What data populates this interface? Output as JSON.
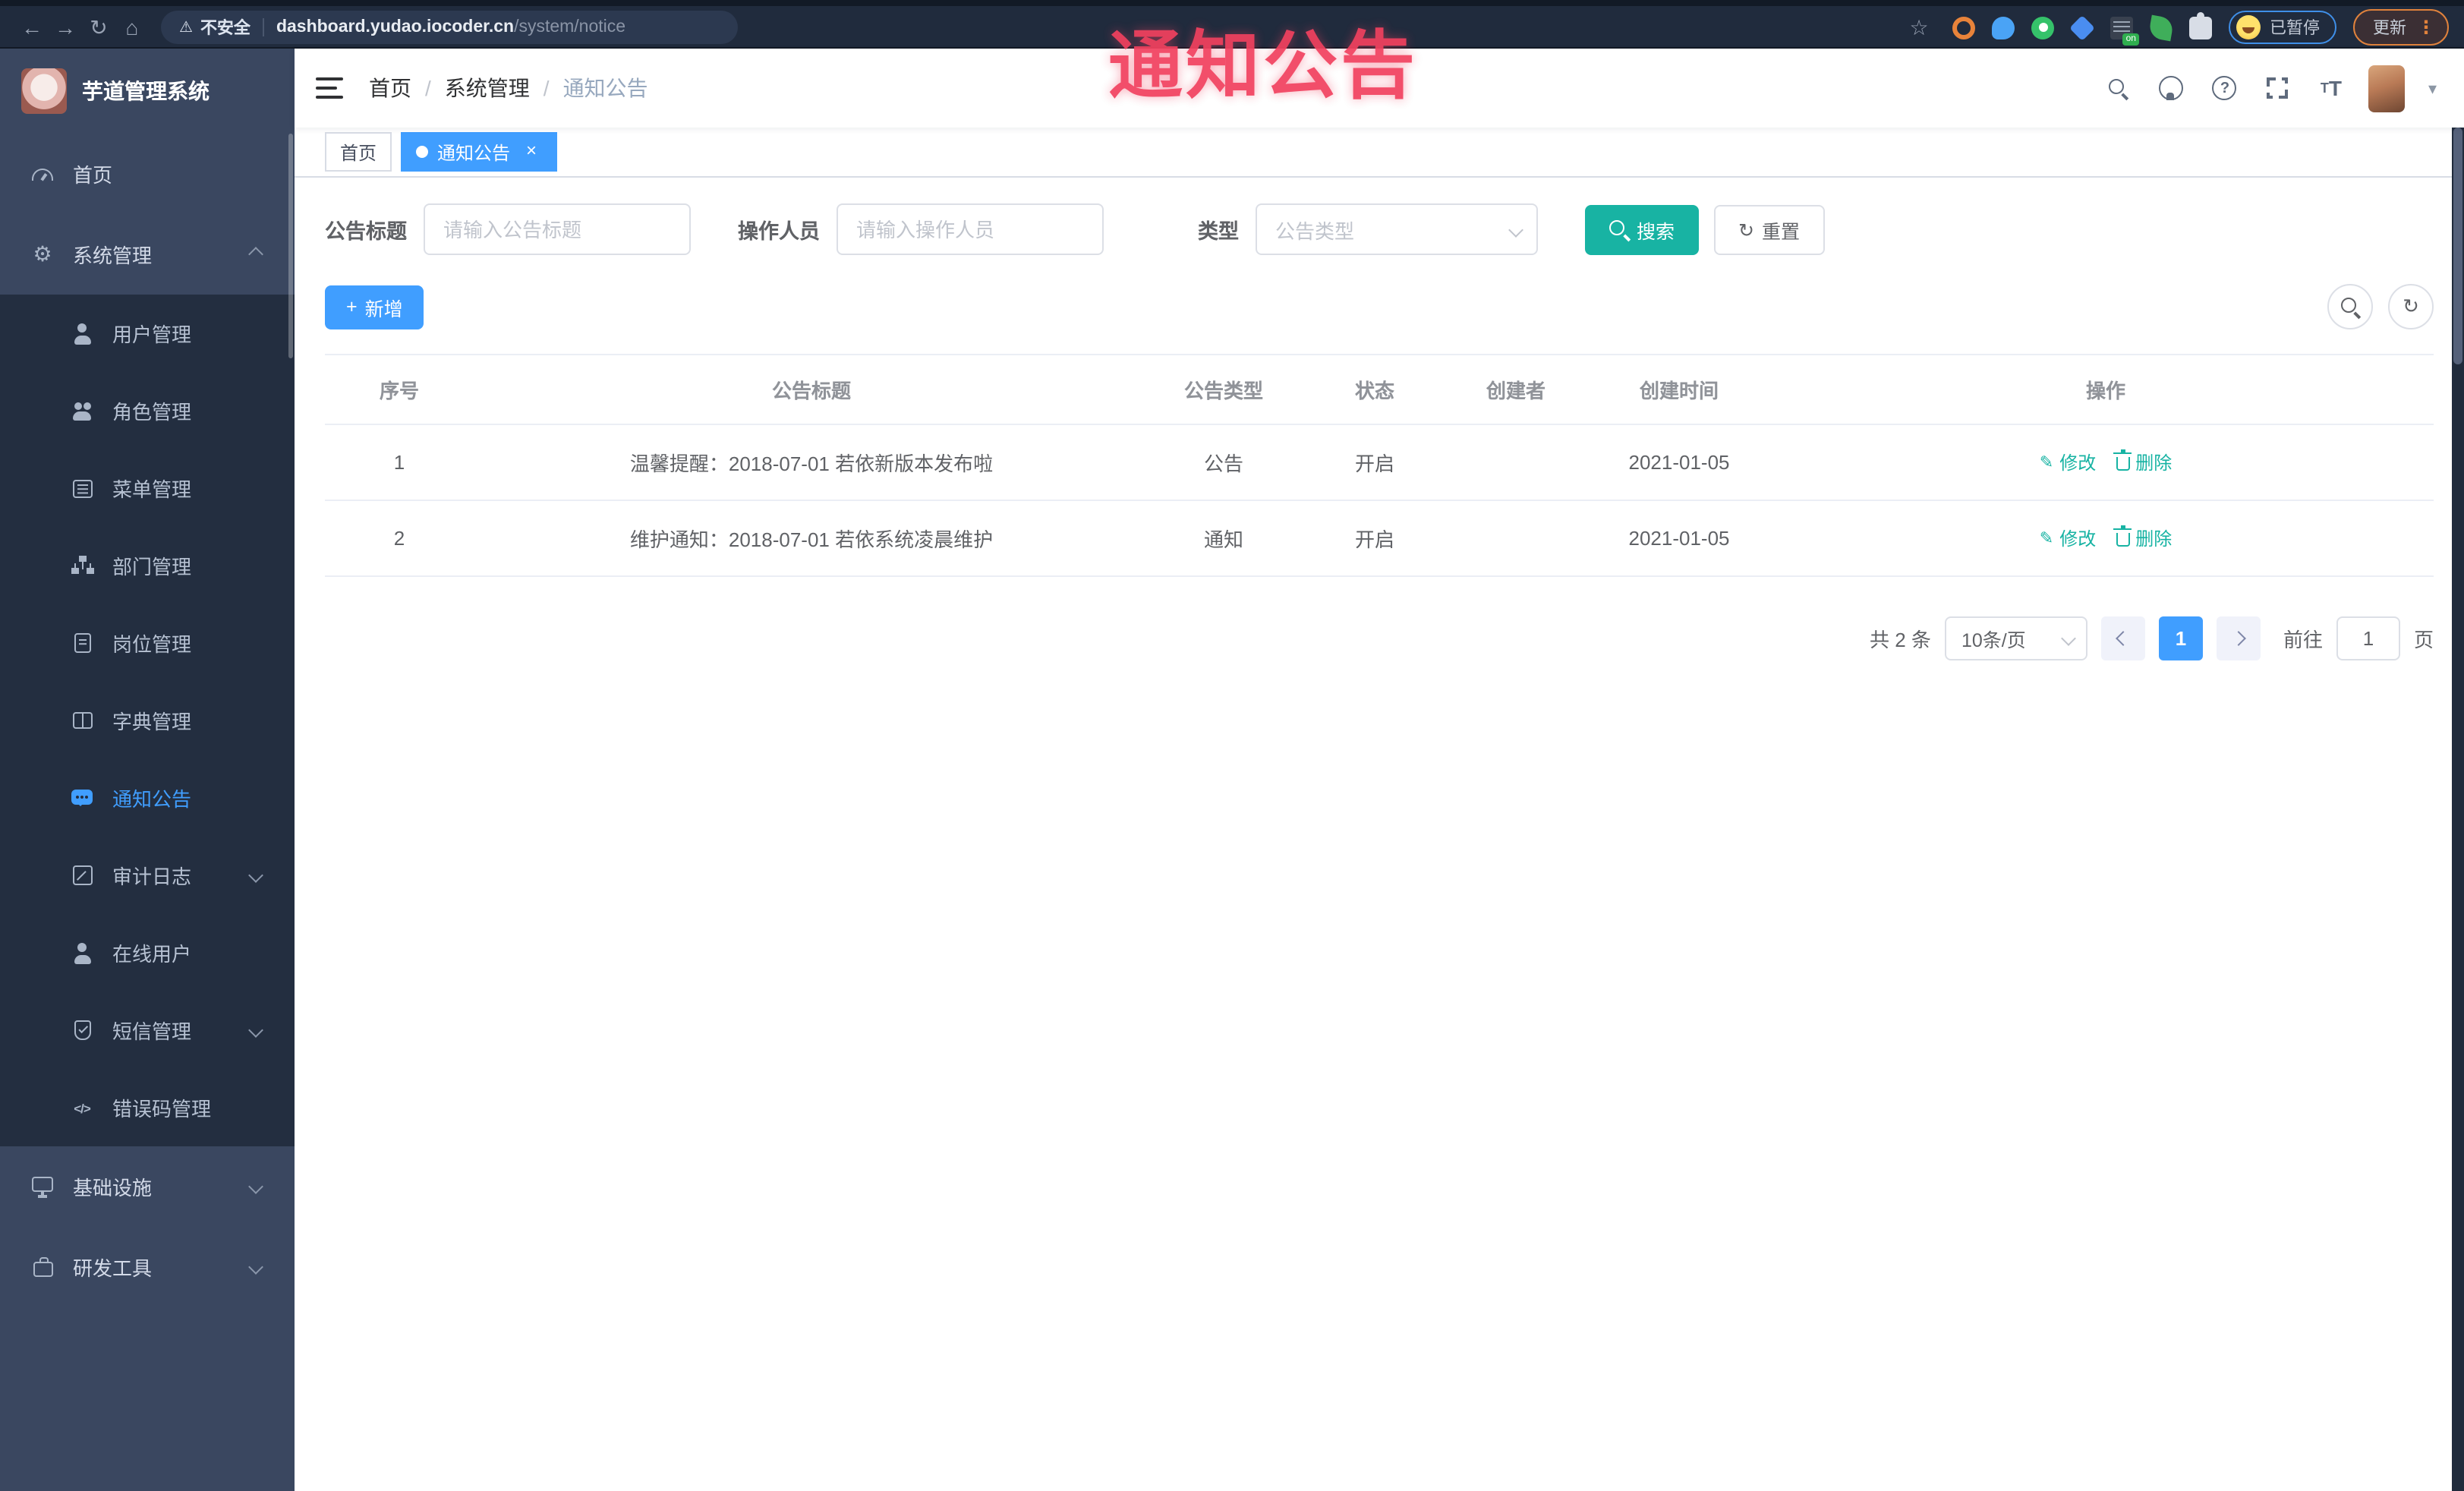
{
  "browser": {
    "security_text": "不安全",
    "url_host": "dashboard.yudao.iocoder.cn",
    "url_path": "/system/notice",
    "on_badge": "on",
    "paused_badge": "已暂停",
    "update_label": "更新"
  },
  "annotation": {
    "text": "通知公告"
  },
  "icons": {
    "back": "←",
    "forward": "→",
    "reload": "↻",
    "home": "⌂",
    "warning": "⚠",
    "star": "☆",
    "dots": "⋮",
    "caret": "▾",
    "question": "?",
    "plus": "+",
    "close": "×",
    "refresh": "↻",
    "edit": "✎",
    "code": "</>",
    "gear": "⚙",
    "font_large": "T",
    "font_small": "T"
  },
  "sidebar": {
    "logo_title": "芋道管理系统",
    "items": [
      {
        "label": "首页"
      },
      {
        "label": "系统管理"
      },
      {
        "label": "基础设施"
      },
      {
        "label": "研发工具"
      }
    ],
    "system_children": [
      "用户管理",
      "角色管理",
      "菜单管理",
      "部门管理",
      "岗位管理",
      "字典管理",
      "通知公告",
      "审计日志",
      "在线用户",
      "短信管理",
      "错误码管理"
    ],
    "active_item": "通知公告"
  },
  "navbar": {
    "breadcrumb": [
      "首页",
      "系统管理",
      "通知公告"
    ]
  },
  "tabs": {
    "items": [
      {
        "label": "首页"
      },
      {
        "label": "通知公告"
      }
    ]
  },
  "filter": {
    "title_label": "公告标题",
    "title_placeholder": "请输入公告标题",
    "operator_label": "操作人员",
    "operator_placeholder": "请输入操作人员",
    "type_label": "类型",
    "type_placeholder": "公告类型",
    "search_label": "搜索",
    "reset_label": "重置"
  },
  "toolbar": {
    "add_label": "新增"
  },
  "table": {
    "headers": [
      "序号",
      "公告标题",
      "公告类型",
      "状态",
      "创建者",
      "创建时间",
      "操作"
    ],
    "rows": [
      {
        "no": "1",
        "title": "温馨提醒：2018-07-01 若依新版本发布啦",
        "type": "公告",
        "status": "开启",
        "creator": "",
        "created": "2021-01-05",
        "edit_label": "修改",
        "delete_label": "删除"
      },
      {
        "no": "2",
        "title": "维护通知：2018-07-01 若依系统凌晨维护",
        "type": "通知",
        "status": "开启",
        "creator": "",
        "created": "2021-01-05",
        "edit_label": "修改",
        "delete_label": "删除"
      }
    ]
  },
  "pagination": {
    "total": "共 2 条",
    "size": "10条/页",
    "page": "1",
    "goto_label": "前往",
    "goto_value": "1",
    "unit": "页"
  },
  "colors": {
    "primary": "#409EFF",
    "search_button": "#18b3a3",
    "action_link": "#17b3a3",
    "annotation": "#f2415f",
    "sidebar_bg": "#3a4760",
    "submenu_bg": "#232e40",
    "browser_bar": "#202b3d"
  }
}
